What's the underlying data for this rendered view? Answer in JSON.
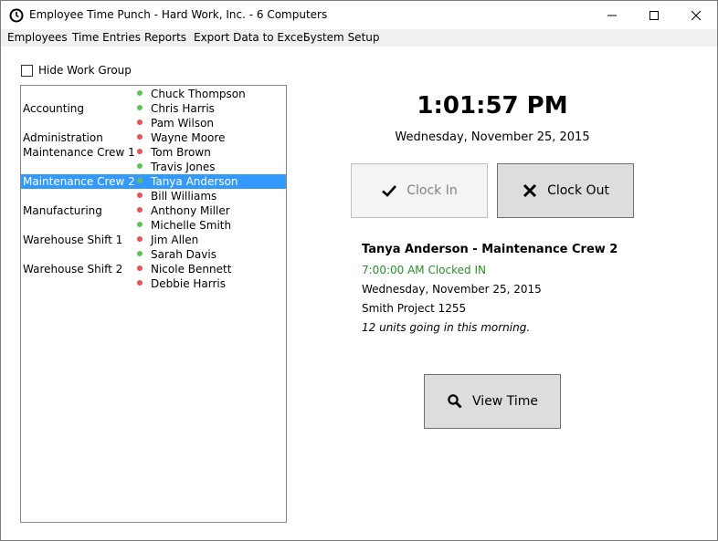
{
  "window": {
    "title": "Employee Time Punch - Hard Work, Inc. - 6 Computers",
    "icon": "clock-icon"
  },
  "menu": [
    "Employees",
    "Time Entries",
    "Reports",
    "Export Data to Excel",
    "System Setup"
  ],
  "hide_work_group": {
    "label": "Hide Work Group",
    "checked": false
  },
  "colors": {
    "in": "#5fbf5f",
    "out": "#e05555",
    "selected": "#3399ff",
    "clocked_in_text": "#2e8b2e"
  },
  "rows": [
    {
      "group": "",
      "name": "Chuck Thompson",
      "status": "in"
    },
    {
      "group": "Accounting",
      "name": "Chris Harris",
      "status": "in"
    },
    {
      "group": "",
      "name": "Pam Wilson",
      "status": "out"
    },
    {
      "group": "Administration",
      "name": "Wayne Moore",
      "status": "out"
    },
    {
      "group": "Maintenance Crew 1",
      "name": "Tom Brown",
      "status": "out"
    },
    {
      "group": "",
      "name": "Travis Jones",
      "status": "in"
    },
    {
      "group": "Maintenance Crew 2",
      "name": "Tanya Anderson",
      "status": "in",
      "selected": true
    },
    {
      "group": "",
      "name": "Bill Williams",
      "status": "out"
    },
    {
      "group": "Manufacturing",
      "name": "Anthony Miller",
      "status": "out"
    },
    {
      "group": "",
      "name": "Michelle Smith",
      "status": "in"
    },
    {
      "group": "Warehouse Shift 1",
      "name": "Jim Allen",
      "status": "out"
    },
    {
      "group": "",
      "name": "Sarah Davis",
      "status": "in"
    },
    {
      "group": "Warehouse Shift 2",
      "name": "Nicole Bennett",
      "status": "out"
    },
    {
      "group": "",
      "name": "Debbie Harris",
      "status": "out"
    }
  ],
  "clock": {
    "time": "1:01:57 PM",
    "date": "Wednesday, November 25, 2015"
  },
  "buttons": {
    "clock_in": {
      "label": "Clock In",
      "icon": "check-icon",
      "enabled": false
    },
    "clock_out": {
      "label": "Clock Out",
      "icon": "x-icon",
      "enabled": true
    },
    "view_time": {
      "label": "View Time",
      "icon": "magnifier-icon",
      "enabled": true
    }
  },
  "detail": {
    "title": "Tanya Anderson - Maintenance Crew 2",
    "status": "7:00:00 AM Clocked IN",
    "date": "Wednesday, November 25, 2015",
    "project": "Smith Project 1255",
    "note": "12 units going in this morning."
  }
}
